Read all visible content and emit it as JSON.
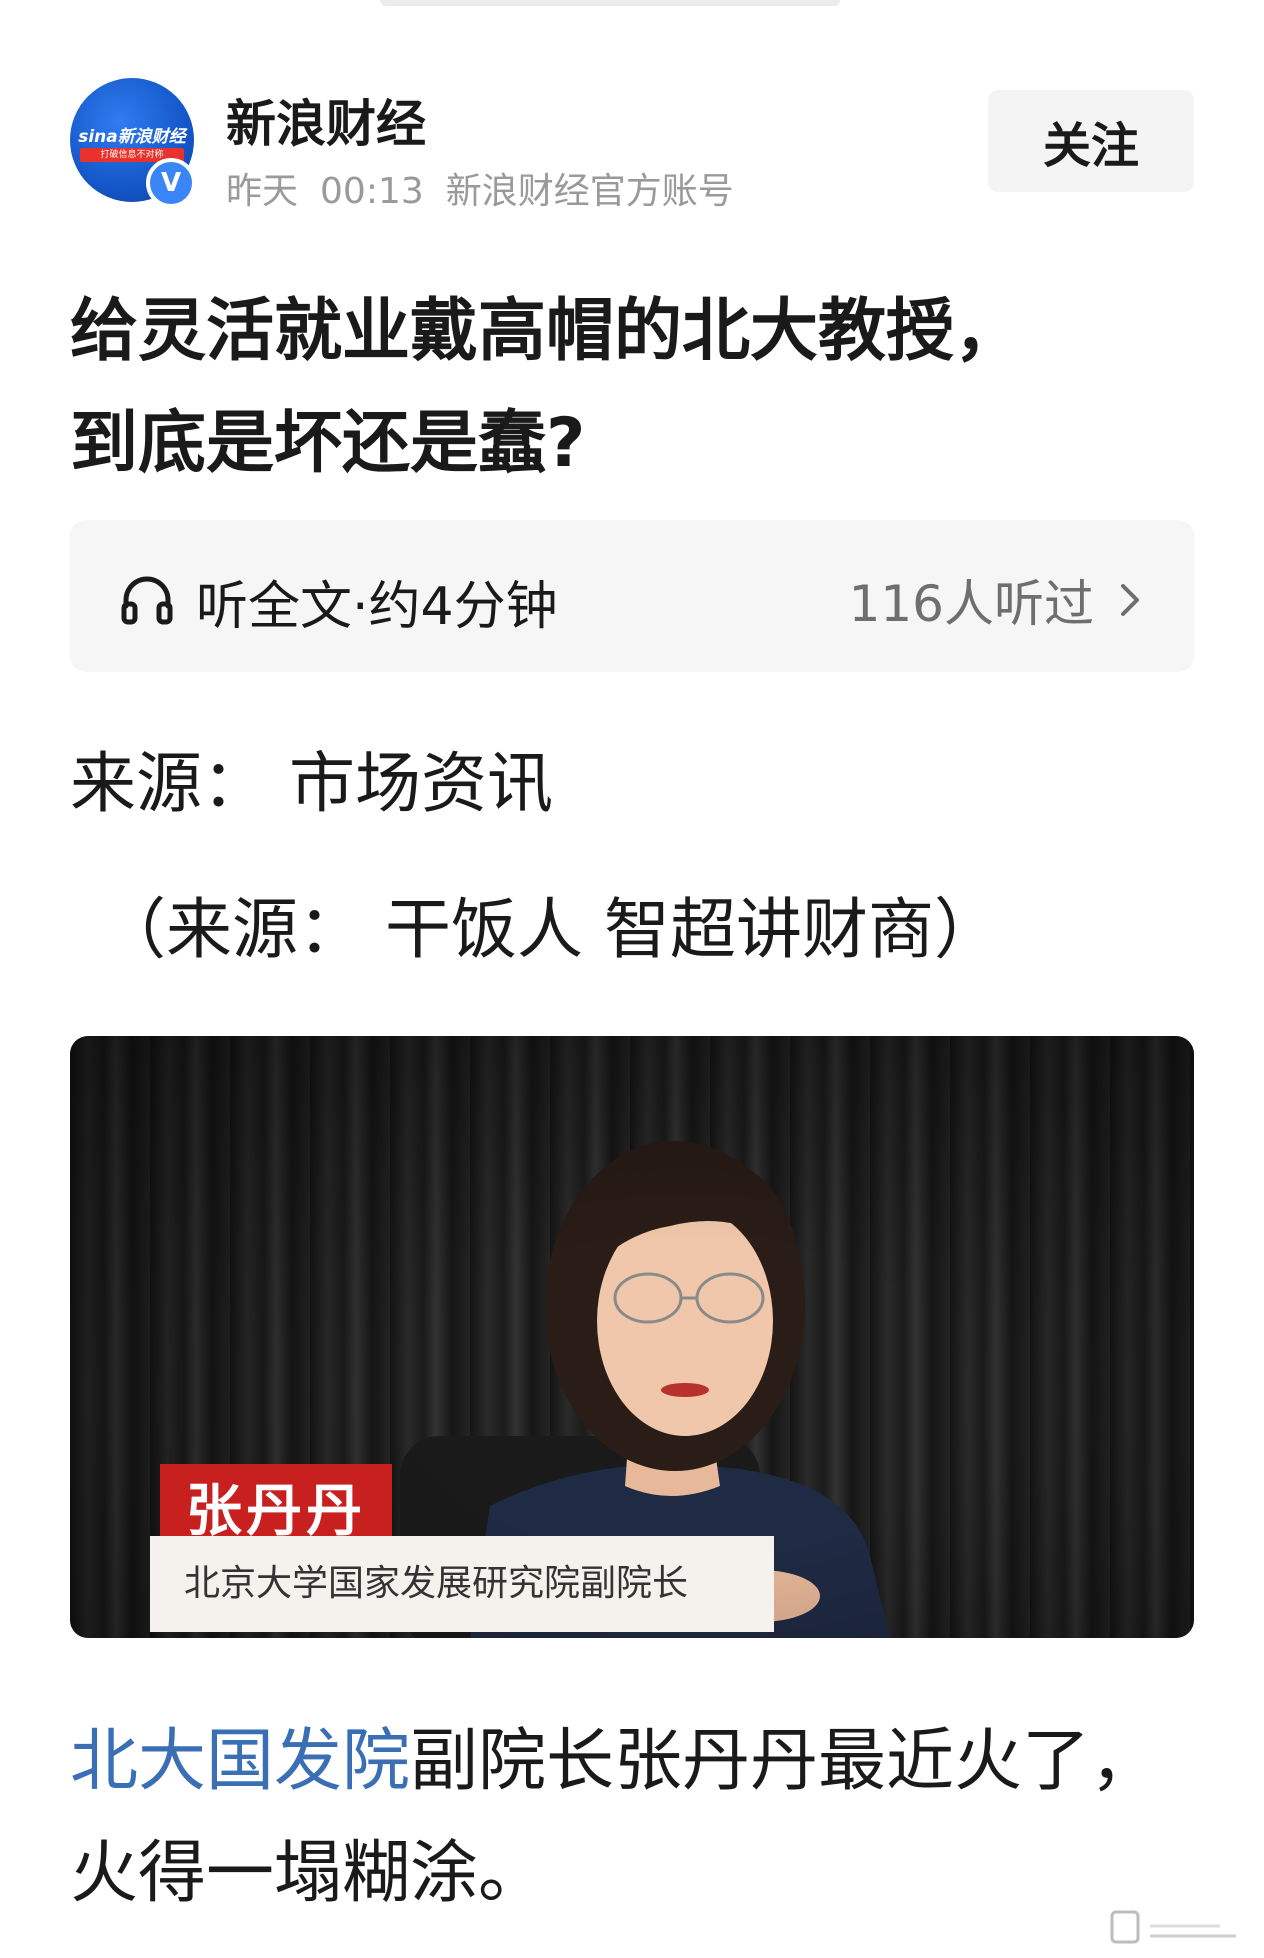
{
  "header": {
    "avatar_logo": "sina新浪财经",
    "avatar_slogan": "打破信息不对称",
    "verified_mark": "V",
    "account_name": "新浪财经",
    "time_day": "昨天",
    "time_clock": "00:13",
    "account_desc": "新浪财经官方账号",
    "follow_label": "关注"
  },
  "article": {
    "title_line1": "给灵活就业戴高帽的北大教授，",
    "title_line2": "到底是坏还是蠢?",
    "listen_label": "听全文·约4分钟",
    "listen_count": "116人听过",
    "source_line": "来源：  市场资讯",
    "source_line2": "（来源：  干饭人 智超讲财商）",
    "image": {
      "name_tag": "张丹丹",
      "title_tag": "北京大学国家发展研究院副院长"
    },
    "body_link": "北大国发院",
    "body_rest": "副院长张丹丹最近火了，火得一塌糊涂。"
  },
  "colors": {
    "link_blue": "#3a6fb5",
    "verified_blue": "#3b86f7",
    "name_tag_red": "#c8201e",
    "muted_gray": "#9a9a9a"
  },
  "icons": [
    "headphones-icon",
    "chevron-right-icon",
    "verified-icon"
  ]
}
